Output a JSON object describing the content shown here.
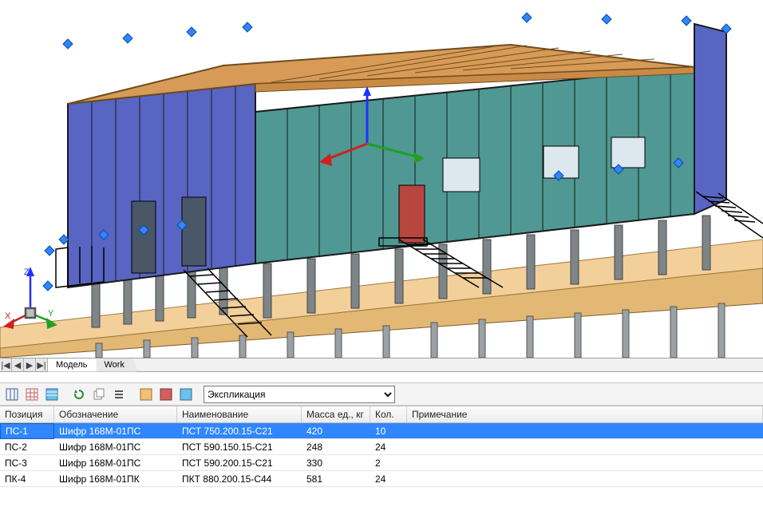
{
  "tabs": {
    "navFirst": "|◀",
    "navPrev": "◀",
    "navNext": "▶",
    "navLast": "▶|",
    "model": "Модель",
    "work": "Work"
  },
  "toolbar": {
    "btn1": "▤",
    "btn2": "▦",
    "btn3": "▥",
    "btn4": "↻",
    "btn5": "⎘",
    "btn6": "☰",
    "btn7": "▨",
    "btn8": "▩",
    "btn9": "▦",
    "dropdown": "Экспликация"
  },
  "grid": {
    "headers": {
      "pos": "Позиция",
      "design": "Обозначение",
      "name": "Наименование",
      "mass": "Масса ед., кг",
      "qty": "Кол.",
      "note": "Примечание"
    },
    "rows": [
      {
        "pos": "ПС-1",
        "design": "Шифр 168М-01ПС",
        "name": "ПСТ 750.200.15-С21",
        "mass": "420",
        "qty": "10",
        "note": "",
        "sel": true
      },
      {
        "pos": "ПС-2",
        "design": "Шифр 168М-01ПС",
        "name": "ПСТ 590.150.15-С21",
        "mass": "248",
        "qty": "24",
        "note": "",
        "sel": false
      },
      {
        "pos": "ПС-3",
        "design": "Шифр 168М-01ПС",
        "name": "ПСТ 590.200.15-С21",
        "mass": "330",
        "qty": "2",
        "note": "",
        "sel": false
      },
      {
        "pos": "ПК-4",
        "design": "Шифр 168М-01ПК",
        "name": "ПКТ 880.200.15-С44",
        "mass": "581",
        "qty": "24",
        "note": "",
        "sel": false
      }
    ]
  },
  "ucs": {
    "x": "X",
    "y": "Y",
    "z": "Z"
  }
}
